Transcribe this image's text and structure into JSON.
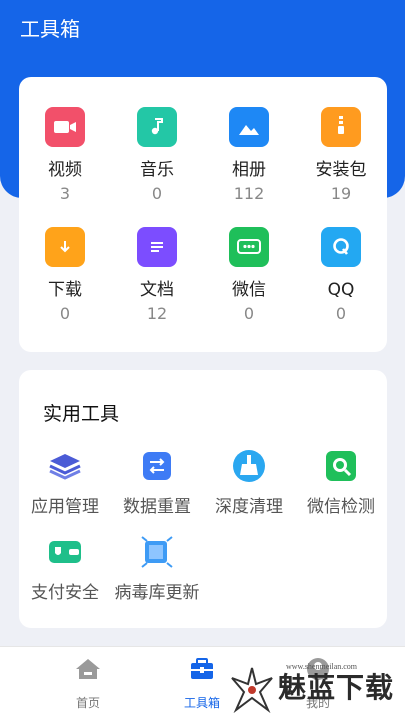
{
  "header": {
    "title": "工具箱"
  },
  "categories": [
    {
      "label": "视频",
      "count": "3",
      "icon": "video-icon",
      "color": "#f2506a"
    },
    {
      "label": "音乐",
      "count": "0",
      "icon": "music-icon",
      "color": "#23c7a6"
    },
    {
      "label": "相册",
      "count": "112",
      "icon": "photo-album-icon",
      "color": "#1e88f5"
    },
    {
      "label": "安装包",
      "count": "19",
      "icon": "package-icon",
      "color": "#ff9b1f"
    },
    {
      "label": "下载",
      "count": "0",
      "icon": "download-folder-icon",
      "color": "#ffa31a"
    },
    {
      "label": "文档",
      "count": "12",
      "icon": "document-icon",
      "color": "#7c4dff"
    },
    {
      "label": "微信",
      "count": "0",
      "icon": "wechat-icon",
      "color": "#1fbf5a"
    },
    {
      "label": "QQ",
      "count": "0",
      "icon": "qq-icon",
      "color": "#23a8f2"
    }
  ],
  "tools": {
    "heading": "实用工具",
    "items": [
      {
        "label": "应用管理",
        "icon": "layers-icon",
        "color": "#4b5bd6"
      },
      {
        "label": "数据重置",
        "icon": "swap-icon",
        "color": "#3e7bf5"
      },
      {
        "label": "深度清理",
        "icon": "broom-icon",
        "color": "#2aa7f0"
      },
      {
        "label": "微信检测",
        "icon": "wechat-scan-icon",
        "color": "#1fbf5a"
      },
      {
        "label": "支付安全",
        "icon": "wallet-shield-icon",
        "color": "#1fbf8a"
      },
      {
        "label": "病毒库更新",
        "icon": "virus-update-icon",
        "color": "#3e9bf5"
      }
    ]
  },
  "nav": {
    "items": [
      {
        "label": "首页",
        "icon": "home-icon"
      },
      {
        "label": "工具箱",
        "icon": "toolbox-icon"
      },
      {
        "label": "我的",
        "icon": "profile-icon"
      }
    ]
  },
  "watermark": {
    "text": "魅蓝下载",
    "url": "www.shenmeilan.com"
  }
}
